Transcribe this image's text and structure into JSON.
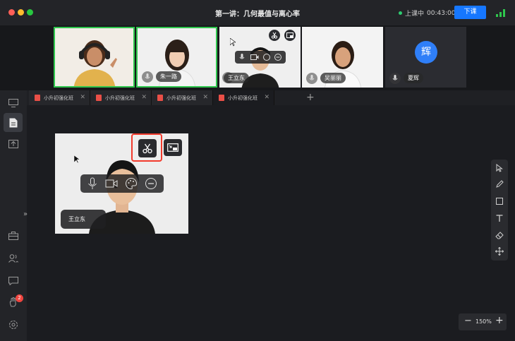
{
  "window": {
    "title": "第一讲：几何最值与离心率",
    "status_label": "上课中",
    "elapsed": "00:43:00",
    "end_class_label": "下课"
  },
  "participants": [
    {
      "name": "",
      "active": true
    },
    {
      "name": "朱一路",
      "active": true
    },
    {
      "name": "王立东",
      "active": false
    },
    {
      "name": "吴丽丽",
      "active": false
    },
    {
      "name": "夏辉",
      "avatar_char": "辉",
      "active": false
    }
  ],
  "tabs": [
    {
      "label": "小升初强化班"
    },
    {
      "label": "小升初强化班"
    },
    {
      "label": "小升初强化班"
    },
    {
      "label": "小升初强化班"
    }
  ],
  "main_video": {
    "name": "王立东"
  },
  "notification_count": "2",
  "zoom": {
    "level": "150%"
  },
  "colors": {
    "accent": "#1677ff",
    "active_border": "#2fc64d",
    "highlight": "#f23b2d",
    "badge": "#f0453f"
  }
}
